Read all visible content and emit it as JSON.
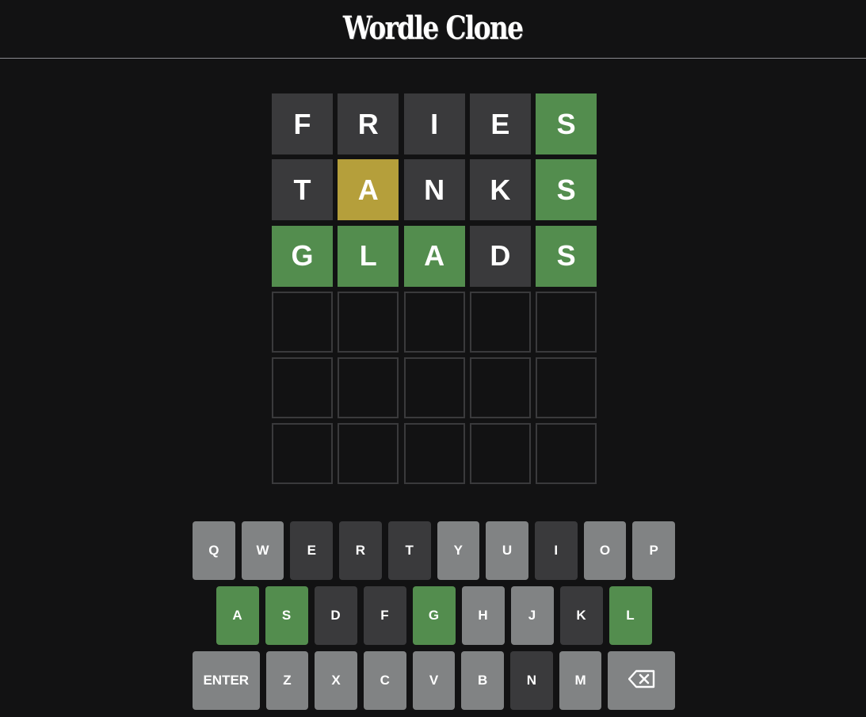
{
  "app": {
    "title": "Wordle Clone"
  },
  "colors": {
    "background": "#121213",
    "correct": "#538d4e",
    "present": "#b59f3b",
    "absent": "#3a3a3c",
    "unused_key": "#818384",
    "empty_border": "#3a3a3c"
  },
  "board": {
    "rows": [
      {
        "tiles": [
          {
            "letter": "F",
            "state": "absent"
          },
          {
            "letter": "R",
            "state": "absent"
          },
          {
            "letter": "I",
            "state": "absent"
          },
          {
            "letter": "E",
            "state": "absent"
          },
          {
            "letter": "S",
            "state": "correct"
          }
        ]
      },
      {
        "tiles": [
          {
            "letter": "T",
            "state": "absent"
          },
          {
            "letter": "A",
            "state": "present"
          },
          {
            "letter": "N",
            "state": "absent"
          },
          {
            "letter": "K",
            "state": "absent"
          },
          {
            "letter": "S",
            "state": "correct"
          }
        ]
      },
      {
        "tiles": [
          {
            "letter": "G",
            "state": "correct"
          },
          {
            "letter": "L",
            "state": "correct"
          },
          {
            "letter": "A",
            "state": "correct"
          },
          {
            "letter": "D",
            "state": "absent"
          },
          {
            "letter": "S",
            "state": "correct"
          }
        ]
      },
      {
        "tiles": [
          {
            "letter": "",
            "state": "empty"
          },
          {
            "letter": "",
            "state": "empty"
          },
          {
            "letter": "",
            "state": "empty"
          },
          {
            "letter": "",
            "state": "empty"
          },
          {
            "letter": "",
            "state": "empty"
          }
        ]
      },
      {
        "tiles": [
          {
            "letter": "",
            "state": "empty"
          },
          {
            "letter": "",
            "state": "empty"
          },
          {
            "letter": "",
            "state": "empty"
          },
          {
            "letter": "",
            "state": "empty"
          },
          {
            "letter": "",
            "state": "empty"
          }
        ]
      },
      {
        "tiles": [
          {
            "letter": "",
            "state": "empty"
          },
          {
            "letter": "",
            "state": "empty"
          },
          {
            "letter": "",
            "state": "empty"
          },
          {
            "letter": "",
            "state": "empty"
          },
          {
            "letter": "",
            "state": "empty"
          }
        ]
      }
    ]
  },
  "keyboard": {
    "rows": [
      [
        {
          "label": "Q",
          "state": "unused"
        },
        {
          "label": "W",
          "state": "unused"
        },
        {
          "label": "E",
          "state": "absent"
        },
        {
          "label": "R",
          "state": "absent"
        },
        {
          "label": "T",
          "state": "absent"
        },
        {
          "label": "Y",
          "state": "unused"
        },
        {
          "label": "U",
          "state": "unused"
        },
        {
          "label": "I",
          "state": "absent"
        },
        {
          "label": "O",
          "state": "unused"
        },
        {
          "label": "P",
          "state": "unused"
        }
      ],
      [
        {
          "label": "A",
          "state": "correct"
        },
        {
          "label": "S",
          "state": "correct"
        },
        {
          "label": "D",
          "state": "absent"
        },
        {
          "label": "F",
          "state": "absent"
        },
        {
          "label": "G",
          "state": "correct"
        },
        {
          "label": "H",
          "state": "unused"
        },
        {
          "label": "J",
          "state": "unused"
        },
        {
          "label": "K",
          "state": "absent"
        },
        {
          "label": "L",
          "state": "correct"
        }
      ],
      [
        {
          "label": "ENTER",
          "state": "unused",
          "wide": true,
          "name": "enter"
        },
        {
          "label": "Z",
          "state": "unused"
        },
        {
          "label": "X",
          "state": "unused"
        },
        {
          "label": "C",
          "state": "unused"
        },
        {
          "label": "V",
          "state": "unused"
        },
        {
          "label": "B",
          "state": "unused"
        },
        {
          "label": "N",
          "state": "absent"
        },
        {
          "label": "M",
          "state": "unused"
        },
        {
          "label": "",
          "state": "unused",
          "wide": true,
          "name": "backspace",
          "icon": "backspace-icon"
        }
      ]
    ]
  }
}
